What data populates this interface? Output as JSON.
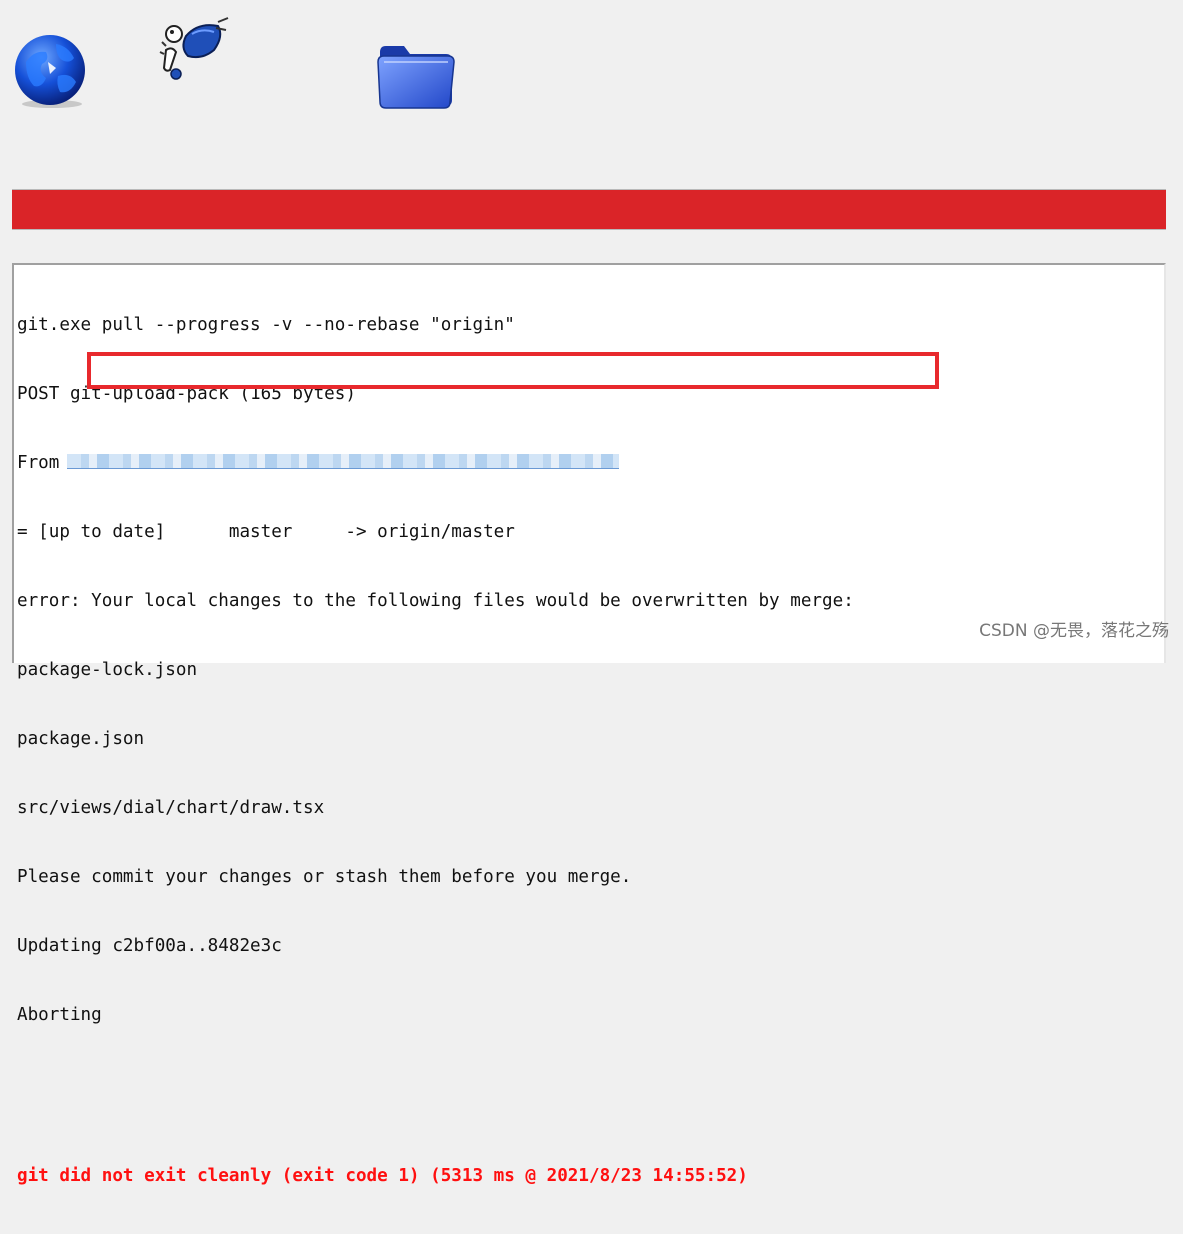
{
  "toolbar": {
    "icons": [
      "globe-icon",
      "tortoise-icon",
      "folder-icon"
    ]
  },
  "status": {
    "color": "#da2428"
  },
  "log": {
    "lines": [
      "git.exe pull --progress -v --no-rebase \"origin\"",
      "POST git-upload-pack (165 bytes)",
      "From",
      "= [up to date]      master     -> origin/master",
      "error: Your local changes to the following files would be overwritten by merge:",
      "package-lock.json",
      "package.json",
      "src/views/dial/chart/draw.tsx",
      "Please commit your changes or stash them before you merge.",
      "Updating c2bf00a..8482e3c",
      "Aborting"
    ],
    "result": "git did not exit cleanly (exit code 1) (5313 ms @ 2021/8/23 14:55:52)",
    "result_color": "#ff1010"
  },
  "watermark": "CSDN @无畏，落花之殇"
}
